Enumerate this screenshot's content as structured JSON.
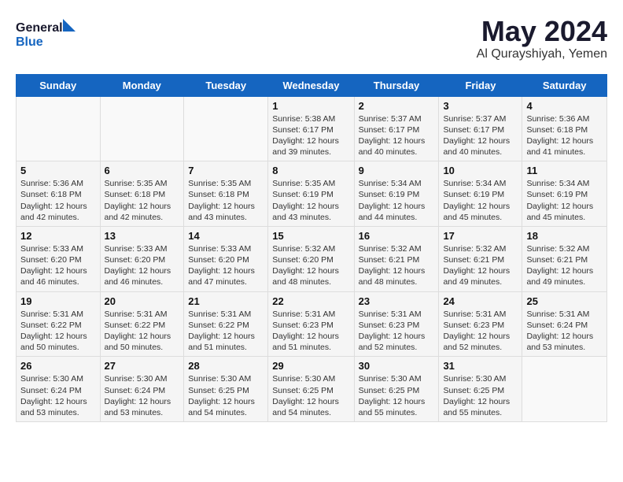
{
  "logo": {
    "line1": "General",
    "line2": "Blue"
  },
  "title": "May 2024",
  "location": "Al Qurayshiyah, Yemen",
  "weekdays": [
    "Sunday",
    "Monday",
    "Tuesday",
    "Wednesday",
    "Thursday",
    "Friday",
    "Saturday"
  ],
  "weeks": [
    [
      {
        "day": "",
        "info": ""
      },
      {
        "day": "",
        "info": ""
      },
      {
        "day": "",
        "info": ""
      },
      {
        "day": "1",
        "info": "Sunrise: 5:38 AM\nSunset: 6:17 PM\nDaylight: 12 hours\nand 39 minutes."
      },
      {
        "day": "2",
        "info": "Sunrise: 5:37 AM\nSunset: 6:17 PM\nDaylight: 12 hours\nand 40 minutes."
      },
      {
        "day": "3",
        "info": "Sunrise: 5:37 AM\nSunset: 6:17 PM\nDaylight: 12 hours\nand 40 minutes."
      },
      {
        "day": "4",
        "info": "Sunrise: 5:36 AM\nSunset: 6:18 PM\nDaylight: 12 hours\nand 41 minutes."
      }
    ],
    [
      {
        "day": "5",
        "info": "Sunrise: 5:36 AM\nSunset: 6:18 PM\nDaylight: 12 hours\nand 42 minutes."
      },
      {
        "day": "6",
        "info": "Sunrise: 5:35 AM\nSunset: 6:18 PM\nDaylight: 12 hours\nand 42 minutes."
      },
      {
        "day": "7",
        "info": "Sunrise: 5:35 AM\nSunset: 6:18 PM\nDaylight: 12 hours\nand 43 minutes."
      },
      {
        "day": "8",
        "info": "Sunrise: 5:35 AM\nSunset: 6:19 PM\nDaylight: 12 hours\nand 43 minutes."
      },
      {
        "day": "9",
        "info": "Sunrise: 5:34 AM\nSunset: 6:19 PM\nDaylight: 12 hours\nand 44 minutes."
      },
      {
        "day": "10",
        "info": "Sunrise: 5:34 AM\nSunset: 6:19 PM\nDaylight: 12 hours\nand 45 minutes."
      },
      {
        "day": "11",
        "info": "Sunrise: 5:34 AM\nSunset: 6:19 PM\nDaylight: 12 hours\nand 45 minutes."
      }
    ],
    [
      {
        "day": "12",
        "info": "Sunrise: 5:33 AM\nSunset: 6:20 PM\nDaylight: 12 hours\nand 46 minutes."
      },
      {
        "day": "13",
        "info": "Sunrise: 5:33 AM\nSunset: 6:20 PM\nDaylight: 12 hours\nand 46 minutes."
      },
      {
        "day": "14",
        "info": "Sunrise: 5:33 AM\nSunset: 6:20 PM\nDaylight: 12 hours\nand 47 minutes."
      },
      {
        "day": "15",
        "info": "Sunrise: 5:32 AM\nSunset: 6:20 PM\nDaylight: 12 hours\nand 48 minutes."
      },
      {
        "day": "16",
        "info": "Sunrise: 5:32 AM\nSunset: 6:21 PM\nDaylight: 12 hours\nand 48 minutes."
      },
      {
        "day": "17",
        "info": "Sunrise: 5:32 AM\nSunset: 6:21 PM\nDaylight: 12 hours\nand 49 minutes."
      },
      {
        "day": "18",
        "info": "Sunrise: 5:32 AM\nSunset: 6:21 PM\nDaylight: 12 hours\nand 49 minutes."
      }
    ],
    [
      {
        "day": "19",
        "info": "Sunrise: 5:31 AM\nSunset: 6:22 PM\nDaylight: 12 hours\nand 50 minutes."
      },
      {
        "day": "20",
        "info": "Sunrise: 5:31 AM\nSunset: 6:22 PM\nDaylight: 12 hours\nand 50 minutes."
      },
      {
        "day": "21",
        "info": "Sunrise: 5:31 AM\nSunset: 6:22 PM\nDaylight: 12 hours\nand 51 minutes."
      },
      {
        "day": "22",
        "info": "Sunrise: 5:31 AM\nSunset: 6:23 PM\nDaylight: 12 hours\nand 51 minutes."
      },
      {
        "day": "23",
        "info": "Sunrise: 5:31 AM\nSunset: 6:23 PM\nDaylight: 12 hours\nand 52 minutes."
      },
      {
        "day": "24",
        "info": "Sunrise: 5:31 AM\nSunset: 6:23 PM\nDaylight: 12 hours\nand 52 minutes."
      },
      {
        "day": "25",
        "info": "Sunrise: 5:31 AM\nSunset: 6:24 PM\nDaylight: 12 hours\nand 53 minutes."
      }
    ],
    [
      {
        "day": "26",
        "info": "Sunrise: 5:30 AM\nSunset: 6:24 PM\nDaylight: 12 hours\nand 53 minutes."
      },
      {
        "day": "27",
        "info": "Sunrise: 5:30 AM\nSunset: 6:24 PM\nDaylight: 12 hours\nand 53 minutes."
      },
      {
        "day": "28",
        "info": "Sunrise: 5:30 AM\nSunset: 6:25 PM\nDaylight: 12 hours\nand 54 minutes."
      },
      {
        "day": "29",
        "info": "Sunrise: 5:30 AM\nSunset: 6:25 PM\nDaylight: 12 hours\nand 54 minutes."
      },
      {
        "day": "30",
        "info": "Sunrise: 5:30 AM\nSunset: 6:25 PM\nDaylight: 12 hours\nand 55 minutes."
      },
      {
        "day": "31",
        "info": "Sunrise: 5:30 AM\nSunset: 6:25 PM\nDaylight: 12 hours\nand 55 minutes."
      },
      {
        "day": "",
        "info": ""
      }
    ]
  ]
}
